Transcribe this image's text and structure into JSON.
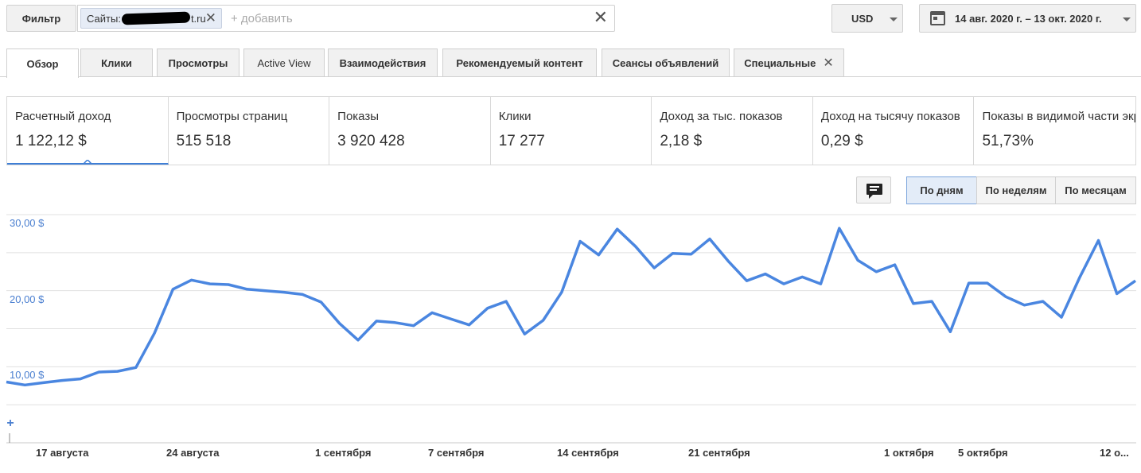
{
  "filter": {
    "button_label": "Фильтр",
    "chip_prefix": "Сайты:",
    "chip_suffix": "t.ru",
    "add_placeholder": "+ добавить"
  },
  "currency": {
    "label": "USD"
  },
  "date_range": {
    "label": "14 авг. 2020 г. – 13 окт. 2020 г."
  },
  "tabs": [
    {
      "label": "Обзор"
    },
    {
      "label": "Клики"
    },
    {
      "label": "Просмотры"
    },
    {
      "label": "Active View"
    },
    {
      "label": "Взаимодействия"
    },
    {
      "label": "Рекомендуемый контент"
    },
    {
      "label": "Сеансы объявлений"
    },
    {
      "label": "Специальные"
    }
  ],
  "metrics": [
    {
      "label": "Расчетный доход",
      "value": "1 122,12 $"
    },
    {
      "label": "Просмотры страниц",
      "value": "515 518"
    },
    {
      "label": "Показы",
      "value": "3 920 428"
    },
    {
      "label": "Клики",
      "value": "17 277"
    },
    {
      "label": "Доход за тыс. показов",
      "value": "2,18 $"
    },
    {
      "label": "Доход на тысячу показов",
      "value": "0,29 $"
    },
    {
      "label": "Показы в видимой части экрана",
      "value": "51,73%"
    }
  ],
  "periods": [
    {
      "label": "По дням"
    },
    {
      "label": "По неделям"
    },
    {
      "label": "По месяцам"
    }
  ],
  "colors": {
    "accent": "#4a86e0",
    "grid": "#e0e0e0"
  },
  "chart_data": {
    "type": "line",
    "ylabel": "",
    "xlabel": "",
    "ylim": [
      0,
      30
    ],
    "y_ticks": [
      "10,00 $",
      "20,00 $",
      "30,00 $"
    ],
    "x_tick_labels": [
      "17 августа",
      "24 августа",
      "1 сентября",
      "7 сентября",
      "14 сентября",
      "21 сентября",
      "1 октября",
      "5 октября",
      "12 о..."
    ],
    "series": [
      {
        "values": [
          8.0,
          7.6,
          7.9,
          8.2,
          8.4,
          9.3,
          9.4,
          9.9,
          14.4,
          20.2,
          21.4,
          20.9,
          20.8,
          20.2,
          20.0,
          19.8,
          19.5,
          18.5,
          15.7,
          13.5,
          16.0,
          15.8,
          15.4,
          17.1,
          16.3,
          15.5,
          17.7,
          18.6,
          14.3,
          16.1,
          19.8,
          26.5,
          24.7,
          28.1,
          25.8,
          23.0,
          24.9,
          24.8,
          26.8,
          23.9,
          21.3,
          22.2,
          20.9,
          21.8,
          20.9,
          28.2,
          24.0,
          22.5,
          23.4,
          18.3,
          18.6,
          14.6,
          21.0,
          21.0,
          19.2,
          18.1,
          18.6,
          16.5,
          21.8,
          26.6,
          19.6,
          21.3
        ]
      }
    ]
  }
}
